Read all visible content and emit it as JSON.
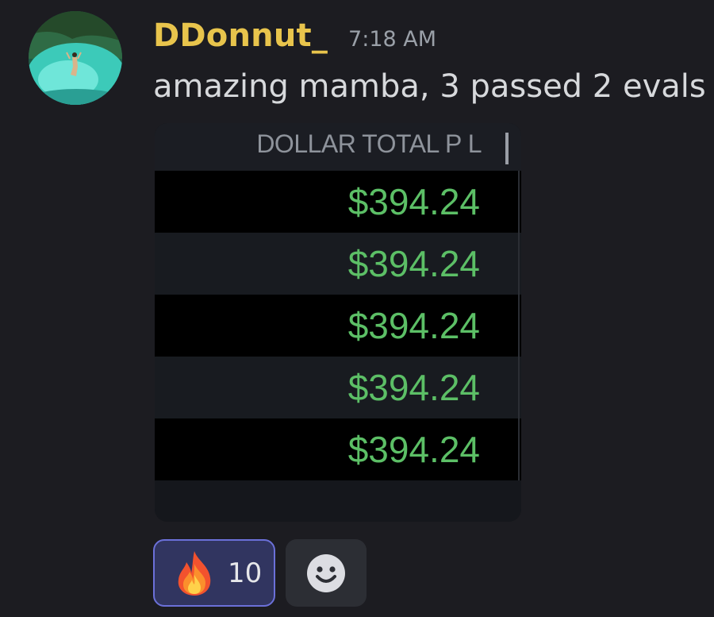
{
  "message": {
    "username": "DDonnut_",
    "timestamp": "7:18 AM",
    "text": "amazing mamba, 3 passed 2 evals"
  },
  "attachment": {
    "column_header": "DOLLAR TOTAL P L",
    "rows": [
      "$394.24",
      "$394.24",
      "$394.24",
      "$394.24",
      "$394.24"
    ],
    "value_color": "#5cbf66"
  },
  "reactions": [
    {
      "emoji": "fire-icon",
      "count": "10",
      "active": true
    }
  ],
  "add_reaction": {
    "icon": "smile-icon"
  },
  "colors": {
    "username": "#e8c44c",
    "background": "#1c1c21",
    "reaction_active_bg": "#313560",
    "reaction_active_border": "#6b70d8"
  }
}
